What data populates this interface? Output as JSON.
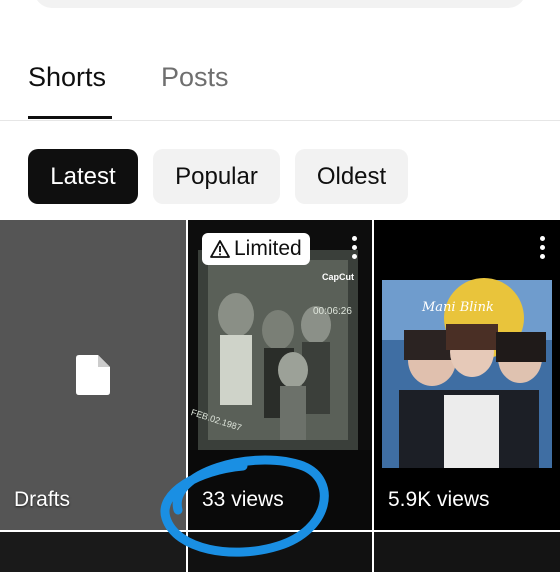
{
  "tabs": [
    {
      "label": "Shorts",
      "active": true
    },
    {
      "label": "Posts",
      "active": false
    }
  ],
  "filters": [
    {
      "label": "Latest",
      "selected": true
    },
    {
      "label": "Popular",
      "selected": false
    },
    {
      "label": "Oldest",
      "selected": false
    }
  ],
  "shorts": [
    {
      "label": "Drafts",
      "type": "drafts"
    },
    {
      "badge": "Limited",
      "views": "33 views",
      "watermark_brand": "CapCut",
      "overlay_text_time": "00:06:26",
      "overlay_text_date": "FEB.02.1987"
    },
    {
      "views": "5.9K views",
      "overlay_title": "Mani Blink"
    }
  ],
  "colors": {
    "accent_dark": "#0f0f0f",
    "chip_bg": "#f2f2f2",
    "draft_bg": "#555555",
    "annotation_circle": "#1a8fe3"
  },
  "icons": {
    "draft": "document-icon",
    "badge": "warning-triangle-icon",
    "menu": "more-vertical-icon"
  }
}
